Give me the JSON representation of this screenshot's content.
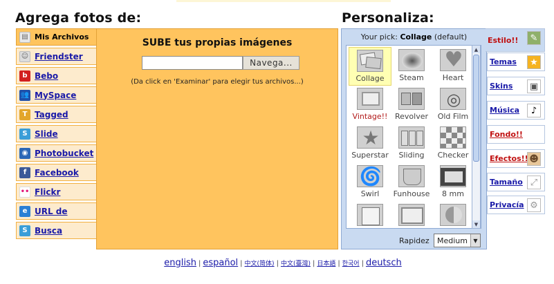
{
  "left_heading": "Agrega fotos de:",
  "right_heading": "Personaliza:",
  "sources": [
    {
      "label": "Mis Archivos",
      "icon": "folder-icon",
      "color": "#e9e9e9",
      "glyph": "▤",
      "active": true
    },
    {
      "label": "Friendster",
      "icon": "smiley-icon",
      "color": "#dddddd",
      "glyph": "☺"
    },
    {
      "label": "Bebo",
      "icon": "bebo-icon",
      "color": "#d21f1f",
      "glyph": "b"
    },
    {
      "label": "MySpace",
      "icon": "people-icon",
      "color": "#1f4fa8",
      "glyph": "👥"
    },
    {
      "label": "Tagged",
      "icon": "tag-icon",
      "color": "#e3a62a",
      "glyph": "T"
    },
    {
      "label": "Slide",
      "icon": "slide-icon",
      "color": "#3a9ed8",
      "glyph": "S"
    },
    {
      "label": "Photobucket",
      "icon": "photobucket-icon",
      "color": "#2b67b6",
      "glyph": "◉"
    },
    {
      "label": "Facebook",
      "icon": "facebook-icon",
      "color": "#3b5998",
      "glyph": "f"
    },
    {
      "label": "Flickr",
      "icon": "flickr-icon",
      "color": "#ffffff",
      "glyph": "••"
    },
    {
      "label": "URL de",
      "icon": "browser-icon",
      "color": "#2a7fd4",
      "glyph": "e"
    },
    {
      "label": "Busca",
      "icon": "search-icon",
      "color": "#3a9ed8",
      "glyph": "S"
    }
  ],
  "upload": {
    "title": "SUBE tus propias imágenes",
    "file_value": "",
    "browse_label": "Navega...",
    "hint": "(Da click en 'Examinar' para elegir tus archivos...)"
  },
  "customize": {
    "pick_prefix": "Your pick:",
    "pick_value": "Collage",
    "pick_suffix": "(default)",
    "styles": [
      {
        "label": "Collage",
        "icon": "collage-icon",
        "selected": true
      },
      {
        "label": "Steam",
        "icon": "steam-icon"
      },
      {
        "label": "Heart",
        "icon": "heart-icon"
      },
      {
        "label": "Vintage!!",
        "icon": "vintage-icon",
        "red": true
      },
      {
        "label": "Revolver",
        "icon": "revolver-icon"
      },
      {
        "label": "Old Film",
        "icon": "film-reel-icon"
      },
      {
        "label": "Superstar",
        "icon": "star-icon"
      },
      {
        "label": "Sliding",
        "icon": "sliding-icon"
      },
      {
        "label": "Checker",
        "icon": "checker-icon"
      },
      {
        "label": "Swirl",
        "icon": "swirl-icon"
      },
      {
        "label": "Funhouse",
        "icon": "funhouse-icon"
      },
      {
        "label": "8 mm",
        "icon": "film-strip-icon"
      },
      {
        "label": "",
        "icon": "page-curl-icon"
      },
      {
        "label": "",
        "icon": "frames-icon"
      },
      {
        "label": "",
        "icon": "split-circle-icon"
      }
    ],
    "speed_label": "Rapidez",
    "speed_value": "Medium"
  },
  "right_tabs": [
    {
      "label": "Estilo!!",
      "icon": "pencil-icon",
      "glyph": "✎",
      "red": true,
      "active": true
    },
    {
      "label": "Temas",
      "icon": "star-icon",
      "glyph": "★"
    },
    {
      "label": "Skins",
      "icon": "skin-icon",
      "glyph": "▣"
    },
    {
      "label": "Música",
      "icon": "music-note-icon",
      "glyph": "♪"
    },
    {
      "label": "Fondo!!",
      "icon": "",
      "glyph": "",
      "red": true
    },
    {
      "label": "Efectos!!",
      "icon": "effects-icon",
      "glyph": "☻",
      "red": true
    },
    {
      "label": "Tamaño",
      "icon": "resize-icon",
      "glyph": "⤢"
    },
    {
      "label": "Privacía",
      "icon": "gear-icon",
      "glyph": "⚙"
    }
  ],
  "languages": [
    {
      "label": "english",
      "small": false
    },
    {
      "label": "español",
      "small": false
    },
    {
      "label": "中文(简体)",
      "small": true
    },
    {
      "label": "中文(臺灣)",
      "small": true
    },
    {
      "label": "日本語",
      "small": true
    },
    {
      "label": "한국어",
      "small": true
    },
    {
      "label": "deutsch",
      "small": false
    }
  ]
}
